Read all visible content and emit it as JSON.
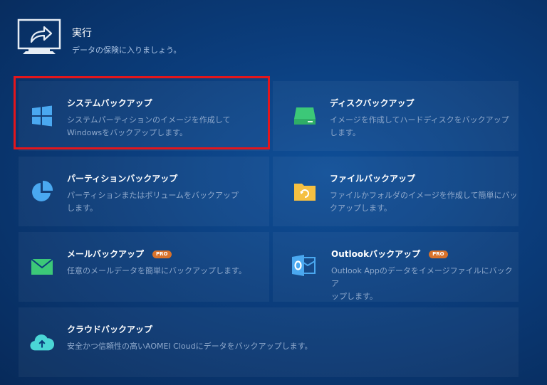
{
  "header": {
    "title": "実行",
    "subtitle": "データの保険に入りましょう。"
  },
  "cards": [
    {
      "title": "システムバックアップ",
      "desc": "システムパーティションのイメージを作成して\nWindowsをバックアップします。",
      "icon": "windows-icon",
      "pro": ""
    },
    {
      "title": "ディスクバックアップ",
      "desc": "イメージを作成してハードディスクをバックアップ\nします。",
      "icon": "disk-icon",
      "pro": ""
    },
    {
      "title": "パーティションバックアップ",
      "desc": "パーティションまたはボリュームをバックアップ\nします。",
      "icon": "partition-pie-icon",
      "pro": ""
    },
    {
      "title": "ファイルバックアップ",
      "desc": "ファイルかフォルダのイメージを作成して簡単にバッ\nクアップします。",
      "icon": "folder-sync-icon",
      "pro": ""
    },
    {
      "title": "メールバックアップ",
      "desc": "任意のメールデータを簡単にバックアップします。",
      "icon": "mail-icon",
      "pro": "PRO"
    },
    {
      "title": "Outlookバックアップ",
      "desc": "Outlook Appのデータをイメージファイルにバックア\nップします。",
      "icon": "outlook-icon",
      "pro": "PRO"
    },
    {
      "title": "クラウドバックアップ",
      "desc": "安全かつ信頼性の高いAOMEI Cloudにデータをバックアップします。",
      "icon": "cloud-upload-icon",
      "pro": ""
    }
  ],
  "colors": {
    "accent_green": "#3cc878",
    "accent_blue": "#4aa8f0",
    "folder_yellow": "#f5c042",
    "pro_orange": "#d9722b",
    "highlight_red": "#e3161c"
  }
}
